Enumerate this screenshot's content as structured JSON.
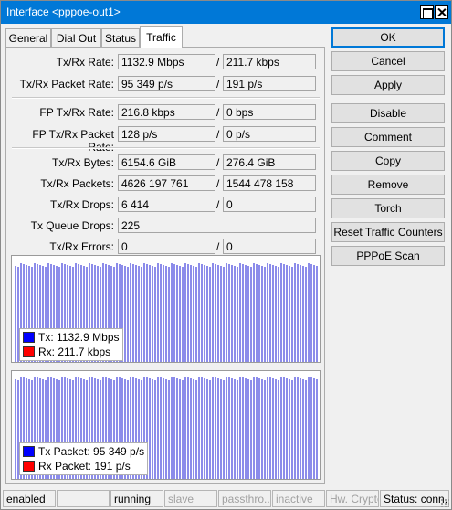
{
  "window": {
    "title": "Interface <pppoe-out1>"
  },
  "tabs": [
    {
      "label": "General"
    },
    {
      "label": "Dial Out"
    },
    {
      "label": "Status"
    },
    {
      "label": "Traffic"
    }
  ],
  "rows": [
    {
      "label": "Tx/Rx Rate:",
      "tx": "1132.9 Mbps",
      "rx": "211.7 kbps"
    },
    {
      "label": "Tx/Rx Packet Rate:",
      "tx": "95 349 p/s",
      "rx": "191 p/s"
    },
    {
      "label": "FP Tx/Rx Rate:",
      "tx": "216.8 kbps",
      "rx": "0 bps"
    },
    {
      "label": "FP Tx/Rx Packet Rate:",
      "tx": "128 p/s",
      "rx": "0 p/s"
    },
    {
      "label": "Tx/Rx Bytes:",
      "tx": "6154.6 GiB",
      "rx": "276.4 GiB"
    },
    {
      "label": "Tx/Rx Packets:",
      "tx": "4626 197 761",
      "rx": "1544 478 158"
    },
    {
      "label": "Tx/Rx Drops:",
      "tx": "6 414",
      "rx": "0"
    },
    {
      "label": "Tx Queue Drops:",
      "value": "225"
    },
    {
      "label": "Tx/Rx Errors:",
      "tx": "0",
      "rx": "0"
    }
  ],
  "slash": "/",
  "graph1": {
    "legend": [
      {
        "label": "Tx:  1132.9 Mbps",
        "color": "#0000ff"
      },
      {
        "label": "Rx:  211.7 kbps",
        "color": "#ff0000"
      }
    ]
  },
  "graph2": {
    "legend": [
      {
        "label": "Tx Packet:  95 349 p/s",
        "color": "#0000ff"
      },
      {
        "label": "Rx Packet:  191 p/s",
        "color": "#ff0000"
      }
    ]
  },
  "buttons": [
    {
      "label": "OK"
    },
    {
      "label": "Cancel"
    },
    {
      "label": "Apply"
    },
    {
      "label": "Disable"
    },
    {
      "label": "Comment"
    },
    {
      "label": "Copy"
    },
    {
      "label": "Remove"
    },
    {
      "label": "Torch"
    },
    {
      "label": "Reset Traffic Counters"
    },
    {
      "label": "PPPoE Scan"
    }
  ],
  "status": [
    {
      "text": "enabled",
      "dim": false
    },
    {
      "text": "",
      "dim": false
    },
    {
      "text": "running",
      "dim": false
    },
    {
      "text": "slave",
      "dim": true
    },
    {
      "text": "passthro...",
      "dim": true
    },
    {
      "text": "inactive",
      "dim": true
    },
    {
      "text": "Hw. Crypto",
      "dim": true
    },
    {
      "text": "Status: conn...",
      "dim": false
    }
  ]
}
